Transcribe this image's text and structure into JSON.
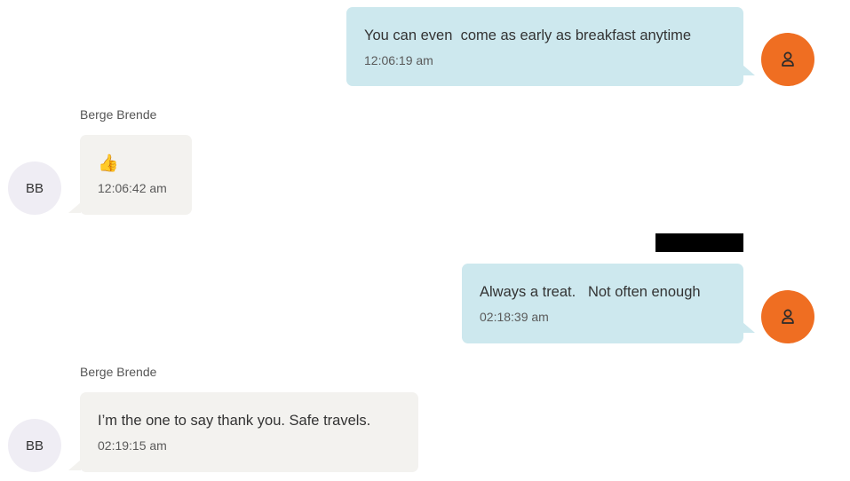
{
  "messages": [
    {
      "direction": "outgoing",
      "text": "You can even  come as early as breakfast anytime",
      "time": "12:06:19 am",
      "avatar_icon": "user-icon"
    },
    {
      "direction": "incoming",
      "sender": "Berge Brende",
      "text": "👍",
      "time": "12:06:42 am",
      "avatar_initials": "BB"
    },
    {
      "direction": "outgoing",
      "text": "Always a treat.   Not often enough",
      "time": "02:18:39 am",
      "avatar_icon": "user-icon"
    },
    {
      "direction": "incoming",
      "sender": "Berge Brende",
      "text": "I’m the one to say thank you. Safe travels.",
      "time": "02:19:15 am",
      "avatar_initials": "BB"
    }
  ],
  "colors": {
    "outgoing_bubble": "#cde8ee",
    "incoming_bubble": "#f3f2ef",
    "my_avatar": "#ef6e22",
    "their_avatar": "#efedf4",
    "redaction": "#000000"
  }
}
